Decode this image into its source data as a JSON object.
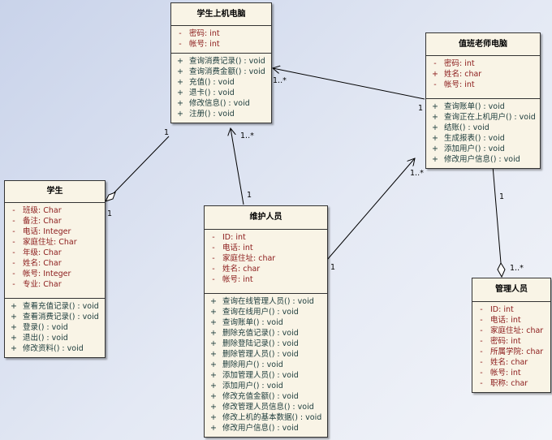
{
  "classes": [
    {
      "id": "student-computer",
      "name": "学生上机电脑",
      "attrs": [
        [
          "-",
          "密码: int"
        ],
        [
          "-",
          "帐号: int"
        ]
      ],
      "ops": [
        [
          "+",
          "查询消费记录() : void"
        ],
        [
          "+",
          "查询消费金额() : void"
        ],
        [
          "+",
          "充值() : void"
        ],
        [
          "+",
          "退卡() : void"
        ],
        [
          "+",
          "修改信息() : void"
        ],
        [
          "+",
          "注册() : void"
        ]
      ]
    },
    {
      "id": "teacher-computer",
      "name": "值班老师电脑",
      "attrs": [
        [
          "-",
          "密码: int"
        ],
        [
          "+",
          "姓名: char"
        ],
        [
          "-",
          "帐号: int"
        ]
      ],
      "ops": [
        [
          "+",
          "查询账单() : void"
        ],
        [
          "+",
          "查询正在上机用户() : void"
        ],
        [
          "+",
          "结账() : void"
        ],
        [
          "+",
          "生成报表() : void"
        ],
        [
          "+",
          "添加用户() : void"
        ],
        [
          "+",
          "修改用户信息() : void"
        ]
      ]
    },
    {
      "id": "student",
      "name": "学生",
      "attrs": [
        [
          "-",
          "班级: Char"
        ],
        [
          "-",
          "备注: Char"
        ],
        [
          "-",
          "电话: Integer"
        ],
        [
          "-",
          "家庭住址: Char"
        ],
        [
          "-",
          "年级: Char"
        ],
        [
          "-",
          "姓名: Char"
        ],
        [
          "-",
          "帐号: Integer"
        ],
        [
          "-",
          "专业: Char"
        ]
      ],
      "ops": [
        [
          "+",
          "查看充值记录() : void"
        ],
        [
          "+",
          "查看消费记录() : void"
        ],
        [
          "+",
          "登录() : void"
        ],
        [
          "+",
          "退出() : void"
        ],
        [
          "+",
          "修改资料() : void"
        ]
      ]
    },
    {
      "id": "maintainer",
      "name": "维护人员",
      "attrs": [
        [
          "-",
          "ID: int"
        ],
        [
          "-",
          "电话: int"
        ],
        [
          "-",
          "家庭住址: char"
        ],
        [
          "-",
          "姓名: char"
        ],
        [
          "-",
          "帐号: int"
        ]
      ],
      "ops": [
        [
          "+",
          "查询在线管理人员() : void"
        ],
        [
          "+",
          "查询在线用户() : void"
        ],
        [
          "+",
          "查询账单() : void"
        ],
        [
          "+",
          "删除充值记录() : void"
        ],
        [
          "+",
          "删除登陆记录() : void"
        ],
        [
          "+",
          "删除管理人员() : void"
        ],
        [
          "+",
          "删除用户() : void"
        ],
        [
          "+",
          "添加管理人员() : void"
        ],
        [
          "+",
          "添加用户() : void"
        ],
        [
          "+",
          "修改充值金额() : void"
        ],
        [
          "+",
          "修改管理人员信息() : void"
        ],
        [
          "+",
          "修改上机的基本数据() : void"
        ],
        [
          "+",
          "修改用户信息() : void"
        ]
      ]
    },
    {
      "id": "admin",
      "name": "管理人员",
      "attrs": [
        [
          "-",
          "ID: int"
        ],
        [
          "-",
          "电话: int"
        ],
        [
          "-",
          "家庭住址: char"
        ],
        [
          "-",
          "密码: int"
        ],
        [
          "-",
          "所属学院: char"
        ],
        [
          "-",
          "姓名: char"
        ],
        [
          "-",
          "帐号: int"
        ],
        [
          "-",
          "职称: char"
        ]
      ],
      "ops": []
    }
  ],
  "multiplicities": [
    "1",
    "1",
    "1..*",
    "1",
    "1..*",
    "1",
    "1",
    "1..*",
    "1",
    "1..*"
  ]
}
